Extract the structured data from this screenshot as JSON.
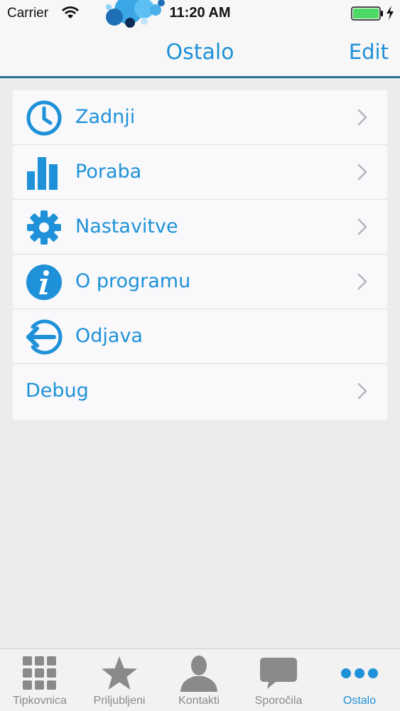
{
  "status_bar": {
    "carrier": "Carrier",
    "time": "11:20 AM",
    "battery_color": "#4cd964"
  },
  "nav": {
    "title": "Ostalo",
    "edit_label": "Edit"
  },
  "menu": {
    "items": [
      {
        "label": "Zadnji",
        "icon": "clock-icon",
        "has_chevron": true
      },
      {
        "label": "Poraba",
        "icon": "bar-chart-icon",
        "has_chevron": true
      },
      {
        "label": "Nastavitve",
        "icon": "gear-icon",
        "has_chevron": true
      },
      {
        "label": "O programu",
        "icon": "info-icon",
        "has_chevron": true
      },
      {
        "label": "Odjava",
        "icon": "logout-icon",
        "has_chevron": false
      },
      {
        "label": "Debug",
        "icon": "",
        "has_chevron": true
      }
    ]
  },
  "tab_bar": {
    "tabs": [
      {
        "label": "Tipkovnica",
        "icon": "keypad-icon",
        "active": false
      },
      {
        "label": "Priljubljeni",
        "icon": "star-icon",
        "active": false
      },
      {
        "label": "Kontakti",
        "icon": "contact-icon",
        "active": false
      },
      {
        "label": "Sporočila",
        "icon": "message-icon",
        "active": false
      },
      {
        "label": "Ostalo",
        "icon": "more-icon",
        "active": true
      }
    ]
  },
  "colors": {
    "accent": "#1f91d8",
    "nav_border": "#2e6f99",
    "inactive_tab": "#8a8a8a"
  }
}
